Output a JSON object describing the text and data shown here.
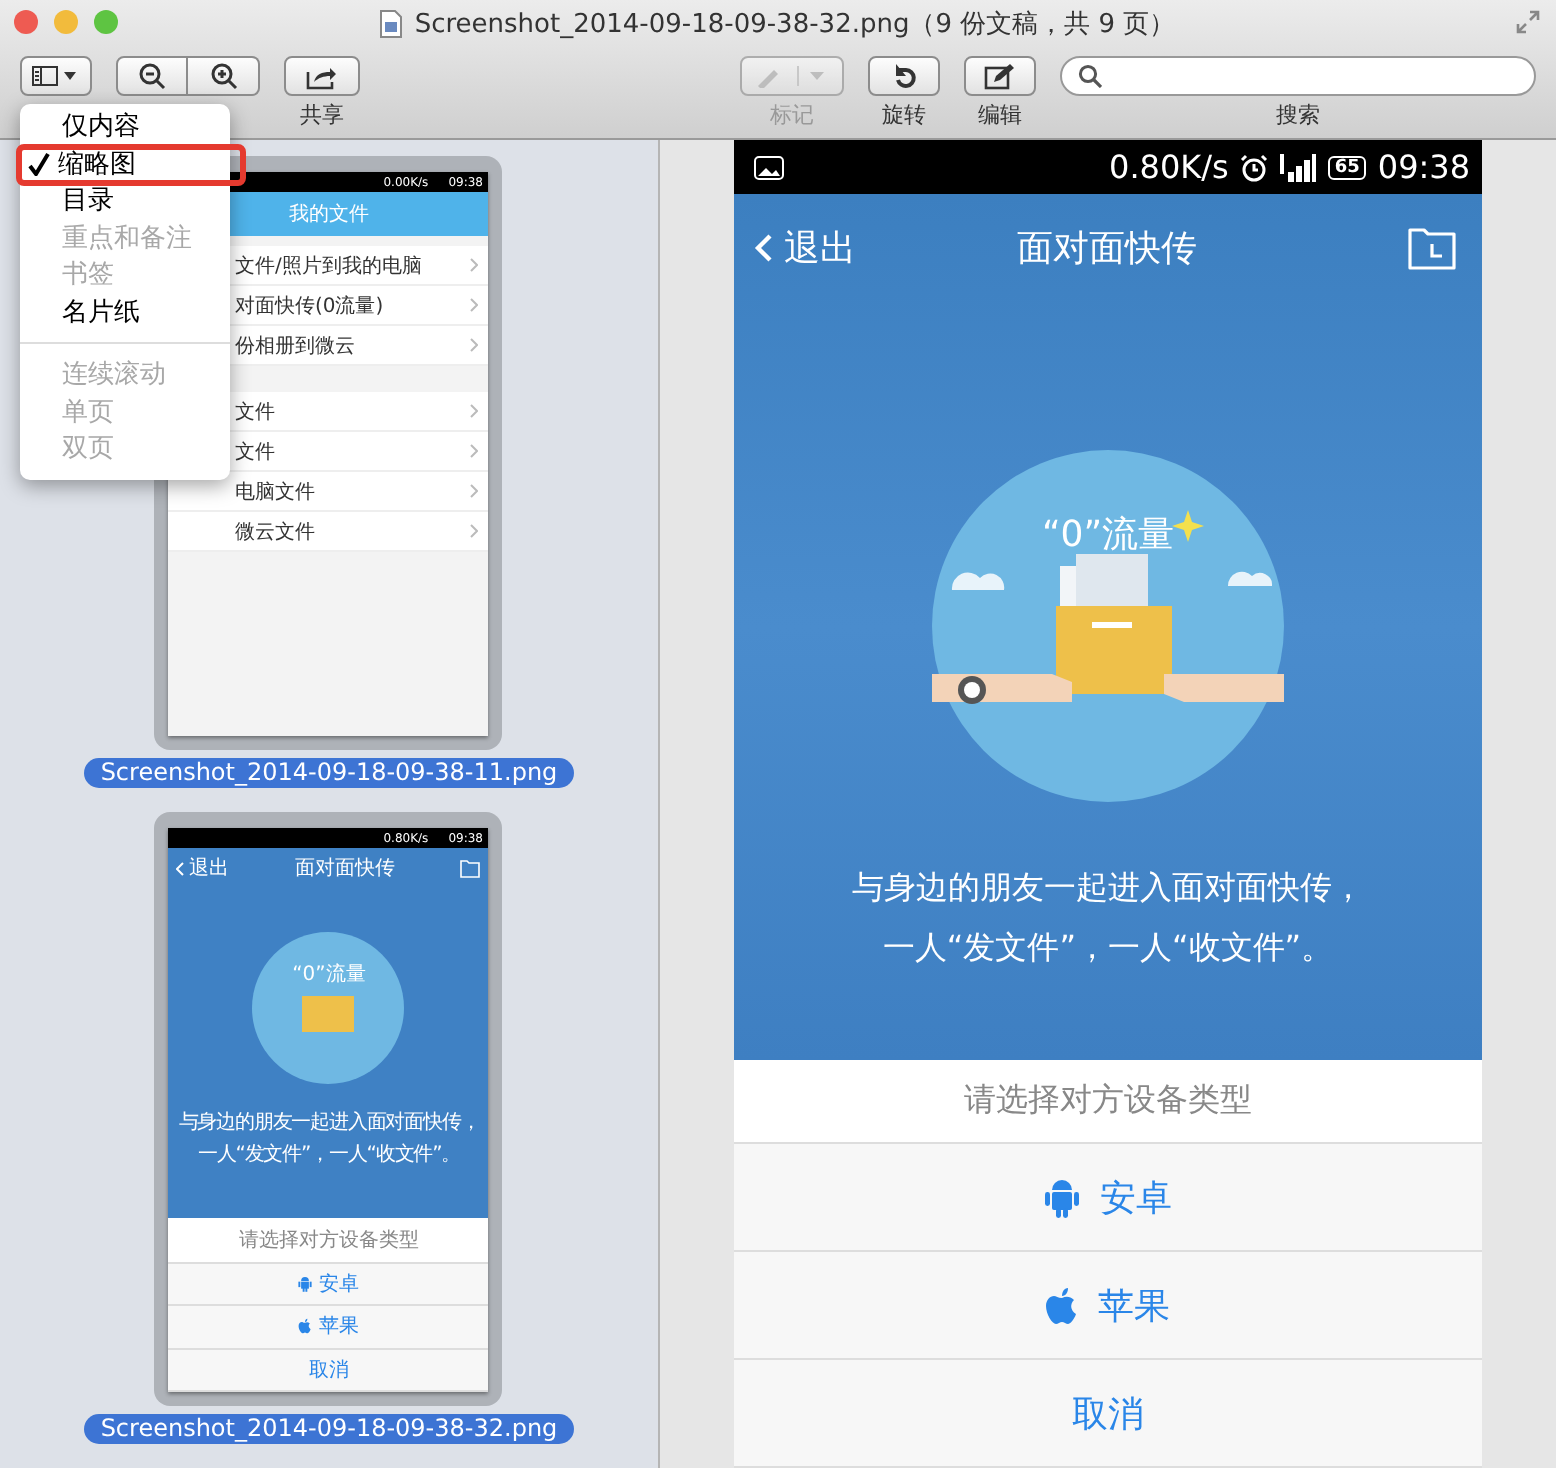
{
  "window": {
    "title": "Screenshot_2014-09-18-09-38-32.png（9 份文稿，共 9 页）"
  },
  "toolbar": {
    "share_label": "共享",
    "markup": {
      "label": "标记",
      "disabled": true
    },
    "rotate_label": "旋转",
    "edit_label": "编辑",
    "search": {
      "label": "搜索"
    }
  },
  "view_menu": {
    "items": [
      {
        "kind": "item",
        "label": "仅内容",
        "checked": false,
        "disabled": false,
        "highlighted": false
      },
      {
        "kind": "item",
        "label": "缩略图",
        "checked": true,
        "disabled": false,
        "highlighted": true
      },
      {
        "kind": "item",
        "label": "目录",
        "checked": false,
        "disabled": false,
        "highlighted": false
      },
      {
        "kind": "item",
        "label": "重点和备注",
        "checked": false,
        "disabled": true,
        "highlighted": false
      },
      {
        "kind": "item",
        "label": "书签",
        "checked": false,
        "disabled": true,
        "highlighted": false
      },
      {
        "kind": "item",
        "label": "名片纸",
        "checked": false,
        "disabled": false,
        "highlighted": false
      },
      {
        "kind": "separator"
      },
      {
        "kind": "item",
        "label": "连续滚动",
        "checked": false,
        "disabled": true,
        "highlighted": false
      },
      {
        "kind": "item",
        "label": "单页",
        "checked": false,
        "disabled": true,
        "highlighted": false
      },
      {
        "kind": "item",
        "label": "双页",
        "checked": false,
        "disabled": true,
        "highlighted": false
      }
    ]
  },
  "thumbnails": [
    {
      "kind": "file_list",
      "caption": "Screenshot_2014-09-18-09-38-11.png",
      "selected": true,
      "speed": "0.00K/s",
      "time": "09:38",
      "header": "我的文件",
      "sections": [
        [
          "文件/照片到我的电脑",
          "对面快传(0流量)",
          "份相册到微云"
        ],
        [
          "文件",
          "文件",
          "电脑文件",
          "微云文件"
        ]
      ]
    },
    {
      "kind": "transfer",
      "caption": "Screenshot_2014-09-18-09-38-32.png",
      "selected": true,
      "speed": "0.80K/s",
      "time": "09:38",
      "back": "退出",
      "title": "面对面快传",
      "badge": "“0”流量",
      "lines": [
        "与身边的朋友一起进入面对面快传，",
        "一人“发文件”，一人“收文件”。"
      ],
      "prompt": "请选择对方设备类型",
      "options": [
        {
          "kind": "android",
          "label": "安卓"
        },
        {
          "kind": "apple",
          "label": "苹果"
        }
      ],
      "cancel": "取消"
    }
  ],
  "page": {
    "status_bar": {
      "speed": "0.80K/s",
      "battery": "65",
      "time": "09:38"
    },
    "nav": {
      "back": "退出",
      "title": "面对面快传"
    },
    "badge": "“0”流量",
    "lines": [
      "与身边的朋友一起进入面对面快传，",
      "一人“发文件”，一人“收文件”。"
    ],
    "sheet": {
      "prompt": "请选择对方设备类型",
      "options": [
        {
          "kind": "android",
          "label": "安卓"
        },
        {
          "kind": "apple",
          "label": "苹果"
        }
      ],
      "cancel": "取消"
    }
  }
}
